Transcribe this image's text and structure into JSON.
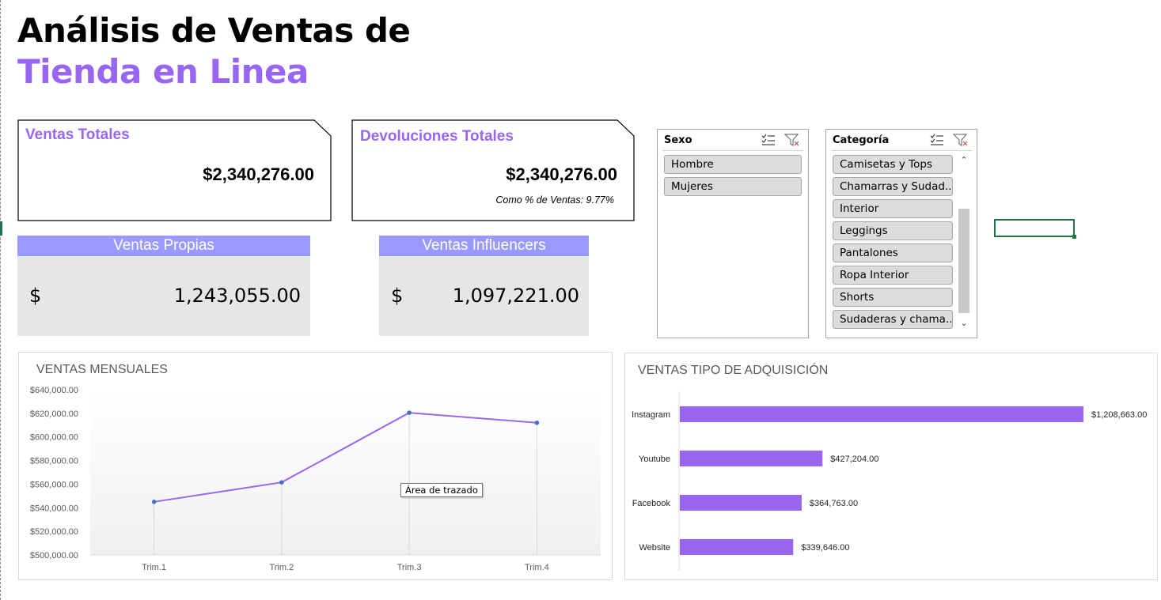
{
  "header": {
    "title_line1": "Análisis de Ventas de",
    "title_line2": "Tienda en Linea"
  },
  "kpis": {
    "ventas_totales": {
      "label": "Ventas Totales",
      "value": "$2,340,276.00"
    },
    "devoluciones_totales": {
      "label": "Devoluciones Totales",
      "value": "$2,340,276.00",
      "sub": "Como % de Ventas: 9.77%"
    }
  },
  "sales": {
    "propias": {
      "label": "Ventas Propias",
      "currency": "$",
      "value": "1,243,055.00"
    },
    "influencers": {
      "label": "Ventas Influencers",
      "currency": "$",
      "value": "1,097,221.00"
    }
  },
  "slicers": {
    "sexo": {
      "title": "Sexo",
      "items": [
        "Hombre",
        "Mujeres"
      ]
    },
    "categoria": {
      "title": "Categoría",
      "items": [
        "Camisetas y Tops",
        "Chamarras y Sudad...",
        "Interior",
        "Leggings",
        "Pantalones",
        "Ropa Interior",
        "Shorts",
        "Sudaderas y chama..."
      ]
    }
  },
  "colors": {
    "accent": "#9966f2",
    "header_band": "#9999ff",
    "box_bg": "#e6e6e6",
    "excel_green": "#217346"
  },
  "icons": {
    "multiselect": "multiselect-icon",
    "clear_filter": "clear-filter-icon",
    "scroll_up": "chevron-up-icon",
    "scroll_down": "chevron-down-icon"
  },
  "tooltip": "Área de trazado",
  "chart_data": [
    {
      "type": "line",
      "title": "VENTAS MENSUALES",
      "categories": [
        "Trim.1",
        "Trim.2",
        "Trim.3",
        "Trim.4"
      ],
      "values": [
        545000,
        561500,
        620500,
        612000
      ],
      "ylim": [
        500000,
        640000
      ],
      "yticks": [
        "$640,000.00",
        "$620,000.00",
        "$600,000.00",
        "$580,000.00",
        "$560,000.00",
        "$540,000.00",
        "$520,000.00",
        "$500,000.00"
      ],
      "xlabel": "",
      "ylabel": "",
      "color": "#9966f2",
      "grid": false
    },
    {
      "type": "bar",
      "orientation": "horizontal",
      "title": "VENTAS TIPO DE ADQUISICIÓN",
      "categories": [
        "Instagram",
        "Youtube",
        "Facebook",
        "Website"
      ],
      "values": [
        1208663,
        427204,
        364763,
        339646
      ],
      "labels": [
        "$1,208,663.00",
        "$427,204.00",
        "$364,763.00",
        "$339,646.00"
      ],
      "color": "#9966f2"
    }
  ]
}
